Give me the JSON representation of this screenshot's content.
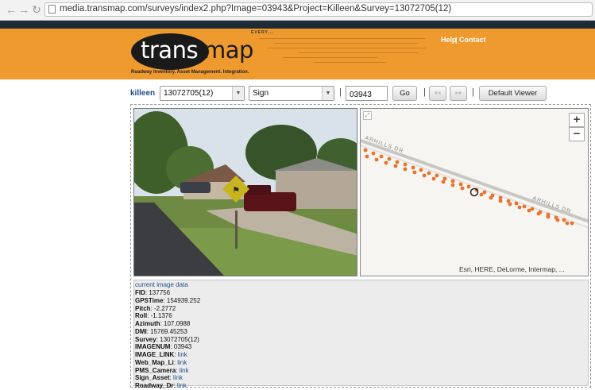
{
  "browser": {
    "back_icon": "back-arrow-icon",
    "forward_icon": "forward-arrow-icon",
    "url": "media.transmap.com/surveys/index2.php?Image=03943&Project=Killeen&Survey=13072705(12)"
  },
  "header": {
    "logo_left": "trans",
    "logo_right": "map",
    "tagline": "Roadway Inventory. Asset Management. Integration.",
    "collage_word": "EVERY...",
    "help_label": "Help",
    "separator": "|",
    "contact_label": "Contact",
    "brand_color": "#ee9a2f"
  },
  "toolbar": {
    "project": "killeen",
    "survey_value": "13072705(12)",
    "layer_value": "Sign",
    "image_number": "03943",
    "pipe": "|",
    "go_label": "Go",
    "prev_label": "↤",
    "next_label": "↦",
    "viewer_label": "Default Viewer"
  },
  "map": {
    "zoom_in": "+",
    "zoom_out": "−",
    "expand_icon": "expand-icon",
    "street_label_1": "ARHILLS DR",
    "street_label_2": "ARHILLS DR",
    "attribution": "Esri, HERE, DeLorme, Intermap, ..."
  },
  "image_data": {
    "title": "current image data",
    "fields": [
      {
        "key": "FID",
        "value": "137756"
      },
      {
        "key": "GPSTime",
        "value": "154939.252"
      },
      {
        "key": "Pitch",
        "value": "-2.2772"
      },
      {
        "key": "Roll",
        "value": "-1.1376"
      },
      {
        "key": "Azimuth",
        "value": "107.0988"
      },
      {
        "key": "DMI",
        "value": "15769.45253"
      },
      {
        "key": "Survey",
        "value": "13072705(12)"
      },
      {
        "key": "IMAGENUM",
        "value": "03943"
      },
      {
        "key": "IMAGE_LINK",
        "value": "link"
      },
      {
        "key": "Web_Map_Li",
        "value": "link"
      },
      {
        "key": "PMS_Camera",
        "value": "link"
      },
      {
        "key": "Sign_Asset",
        "value": "link"
      },
      {
        "key": "Roadway_Dr",
        "value": "link"
      }
    ]
  }
}
